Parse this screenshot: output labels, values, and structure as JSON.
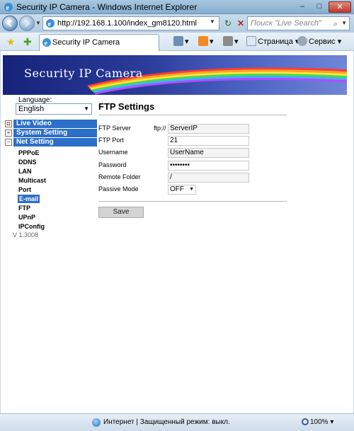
{
  "window": {
    "title": "Security IP Camera - Windows Internet Explorer",
    "minimize": "–",
    "maximize": "□",
    "close": "✕"
  },
  "address": {
    "url": "http://192.168.1.100/index_gm8120.html",
    "search_placeholder": "Поиск \"Live Search\""
  },
  "command_bar": {
    "tab_title": "Security IP Camera",
    "page_label": "Страница",
    "tools_label": "Сервис"
  },
  "banner": {
    "logo_text": "Security IP Camera"
  },
  "sidebar": {
    "language_label": "Language:",
    "language_value": "English",
    "menus": [
      {
        "label": "Live Video"
      },
      {
        "label": "System Setting"
      },
      {
        "label": "Net Setting"
      }
    ],
    "submenu": [
      {
        "label": "PPPoE"
      },
      {
        "label": "DDNS"
      },
      {
        "label": "LAN"
      },
      {
        "label": "Multicast"
      },
      {
        "label": "Port"
      },
      {
        "label": "E-mail"
      },
      {
        "label": "FTP"
      },
      {
        "label": "UPnP"
      },
      {
        "label": "IPConfig"
      }
    ],
    "version": "V 1.3008"
  },
  "ftp": {
    "heading": "FTP Settings",
    "server_label": "FTP Server",
    "server_prefix": "ftp://",
    "server_value": "ServerIP",
    "port_label": "FTP Port",
    "port_value": "21",
    "username_label": "Username",
    "username_value": "UserName",
    "password_label": "Password",
    "password_value": "••••••••",
    "folder_label": "Remote Folder",
    "folder_value": "/",
    "passive_label": "Passive Mode",
    "passive_value": "OFF",
    "save_label": "Save"
  },
  "status": {
    "text": "Интернет | Защищенный режим: выкл.",
    "zoom": "100%"
  },
  "colors": {
    "menu_blue": "#2c6fc8",
    "banner_dark": "#16237a"
  }
}
